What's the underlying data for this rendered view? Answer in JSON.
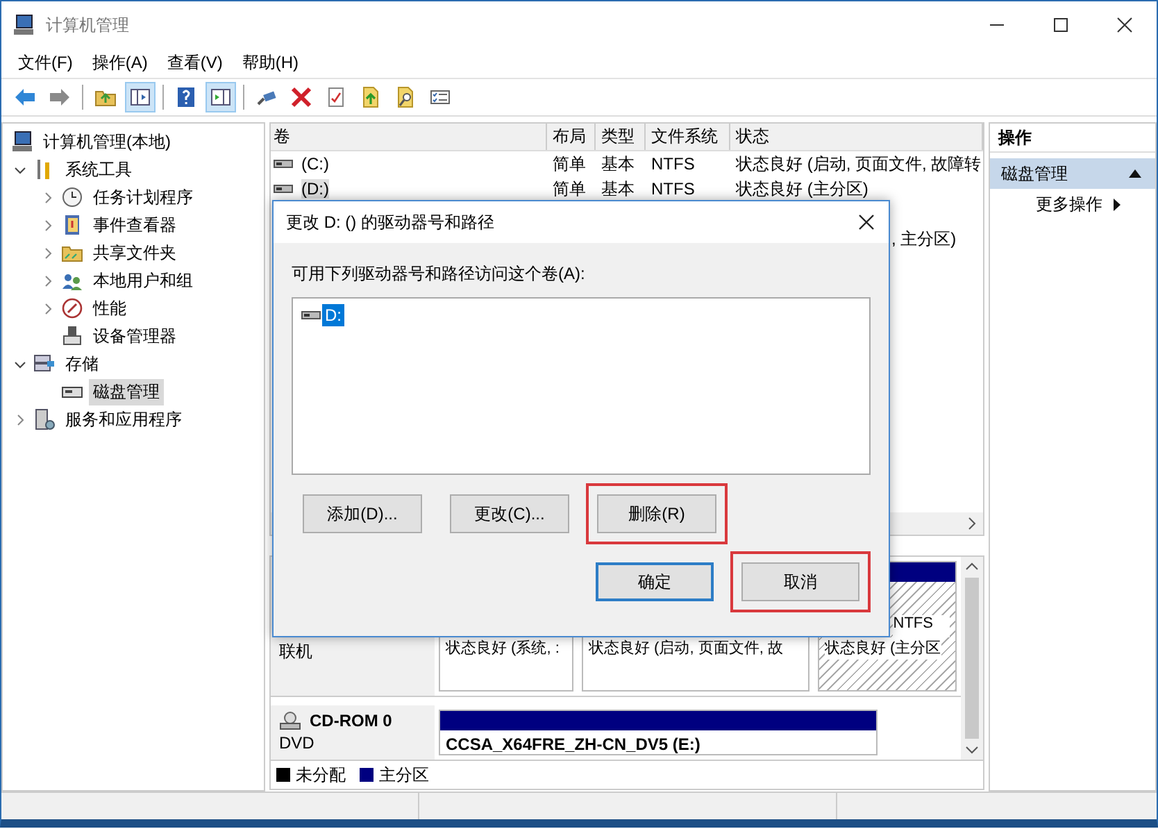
{
  "window": {
    "title": "计算机管理"
  },
  "menu": [
    {
      "label": "文件(F)"
    },
    {
      "label": "操作(A)"
    },
    {
      "label": "查看(V)"
    },
    {
      "label": "帮助(H)"
    }
  ],
  "toolbar": [
    {
      "kind": "back",
      "pressed": false
    },
    {
      "kind": "forward",
      "pressed": false
    },
    {
      "kind": "sep"
    },
    {
      "kind": "up",
      "pressed": false
    },
    {
      "kind": "tree",
      "pressed": true
    },
    {
      "kind": "sep"
    },
    {
      "kind": "help",
      "pressed": false
    },
    {
      "kind": "pane",
      "pressed": true
    },
    {
      "kind": "sep"
    },
    {
      "kind": "connect",
      "pressed": false
    },
    {
      "kind": "delete",
      "pressed": false
    },
    {
      "kind": "properties",
      "pressed": false
    },
    {
      "kind": "export",
      "pressed": false
    },
    {
      "kind": "find",
      "pressed": false
    },
    {
      "kind": "list",
      "pressed": false
    }
  ],
  "tree": [
    {
      "label": "计算机管理(本地)",
      "selected": false,
      "children": [
        {
          "label": "系统工具",
          "expanded": true,
          "selected": false,
          "children": [
            {
              "label": "任务计划程序",
              "expanded": false,
              "selected": false
            },
            {
              "label": "事件查看器",
              "expanded": false,
              "selected": false
            },
            {
              "label": "共享文件夹",
              "expanded": false,
              "selected": false
            },
            {
              "label": "本地用户和组",
              "expanded": false,
              "selected": false
            },
            {
              "label": "性能",
              "expanded": false,
              "selected": false
            },
            {
              "label": "设备管理器",
              "selected": false
            }
          ]
        },
        {
          "label": "存储",
          "expanded": true,
          "selected": false,
          "children": [
            {
              "label": "磁盘管理",
              "selected": true
            }
          ]
        },
        {
          "label": "服务和应用程序",
          "expanded": false,
          "selected": false
        }
      ]
    }
  ],
  "volumes": {
    "columns": [
      {
        "label": "卷"
      },
      {
        "label": "布局"
      },
      {
        "label": "类型"
      },
      {
        "label": "文件系统"
      },
      {
        "label": "状态"
      }
    ],
    "rows": [
      {
        "cells": [
          "(C:)",
          "简单",
          "基本",
          "NTFS",
          "状态良好 (启动, 页面文件, 故障转"
        ],
        "selected": false
      },
      {
        "cells": [
          "(D:)",
          "简单",
          "基本",
          "NTFS",
          "状态良好 (主分区)"
        ],
        "selected": true
      },
      {
        "kind": "partial",
        "status": ", 主分区)"
      }
    ]
  },
  "disks": [
    {
      "kind": "basic",
      "status": "联机",
      "partitions": [
        {
          "status": "状态良好 (系统, :",
          "selected": false
        },
        {
          "status": "状态良好 (启动, 页面文件, 故",
          "selected": false
        },
        {
          "fs": "NTFS",
          "status": "状态良好 (主分区",
          "selected": true
        }
      ]
    },
    {
      "kind": "optical",
      "name": "CD-ROM 0",
      "type": "DVD",
      "partitions": [
        {
          "label": "CCSA_X64FRE_ZH-CN_DV5 (E:)",
          "selected": false
        }
      ]
    }
  ],
  "legend": [
    {
      "label": "未分配",
      "color": "#000000"
    },
    {
      "label": "主分区",
      "color": "#000080"
    }
  ],
  "actions": {
    "header": "操作",
    "sections": [
      {
        "title": "磁盘管理",
        "items": [
          {
            "label": "更多操作"
          }
        ]
      }
    ]
  },
  "dialog": {
    "title": "更改 D: () 的驱动器号和路径",
    "prompt": "可用下列驱动器号和路径访问这个卷(A):",
    "paths": [
      {
        "label": "D:",
        "selected": true
      }
    ],
    "actions": [
      {
        "label": "添加(D)...",
        "highlighted": false
      },
      {
        "label": "更改(C)...",
        "highlighted": false
      },
      {
        "label": "删除(R)",
        "highlighted": true
      }
    ],
    "buttons": [
      {
        "label": "确定",
        "default": true,
        "highlighted": false
      },
      {
        "label": "取消",
        "default": false,
        "highlighted": true
      }
    ]
  }
}
